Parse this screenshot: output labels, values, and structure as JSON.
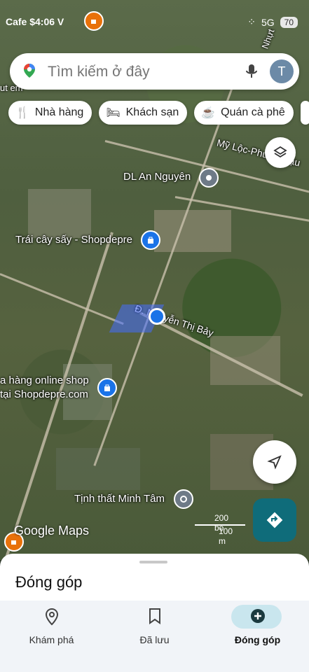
{
  "status_bar": {
    "left": "Cafe $4:06 V",
    "network": "5G",
    "battery": "70"
  },
  "search": {
    "placeholder": "Tìm kiếm ở đây",
    "avatar_letter": "T"
  },
  "chips": [
    {
      "label": "Nhà hàng",
      "icon": "restaurant-icon"
    },
    {
      "label": "Khách sạn",
      "icon": "hotel-icon"
    },
    {
      "label": "Quán cà phê",
      "icon": "coffee-icon"
    }
  ],
  "map": {
    "road_labels": [
      "Mỹ Lộc-Phước Hậu",
      "Đ. Nguyễn Thị Bảy",
      "Nhựt"
    ],
    "places": [
      {
        "name": "DL An Nguyên",
        "icon": "place-pin-icon"
      },
      {
        "name": "Trái cây sấy - Shopdepre",
        "icon": "shopping-bag-icon"
      },
      {
        "name": "a hàng online shop",
        "name2": "tại Shopdepre.com",
        "icon": "shopping-bag-icon"
      },
      {
        "name": "Tịnh thất Minh Tâm",
        "icon": "temple-icon"
      }
    ],
    "scale": {
      "top": "200 bộ",
      "bottom": "100 m"
    },
    "brand": "Google Maps",
    "overlay_text": "ut em"
  },
  "sheet": {
    "title": "Đóng góp"
  },
  "nav": [
    {
      "label": "Khám phá",
      "icon": "explore-pin-icon"
    },
    {
      "label": "Đã lưu",
      "icon": "bookmark-icon"
    },
    {
      "label": "Đóng góp",
      "icon": "add-circle-icon",
      "active": true
    }
  ],
  "colors": {
    "accent": "#1a73e8",
    "directions": "#0f6c7a",
    "nav_active": "#c9e6ee"
  }
}
